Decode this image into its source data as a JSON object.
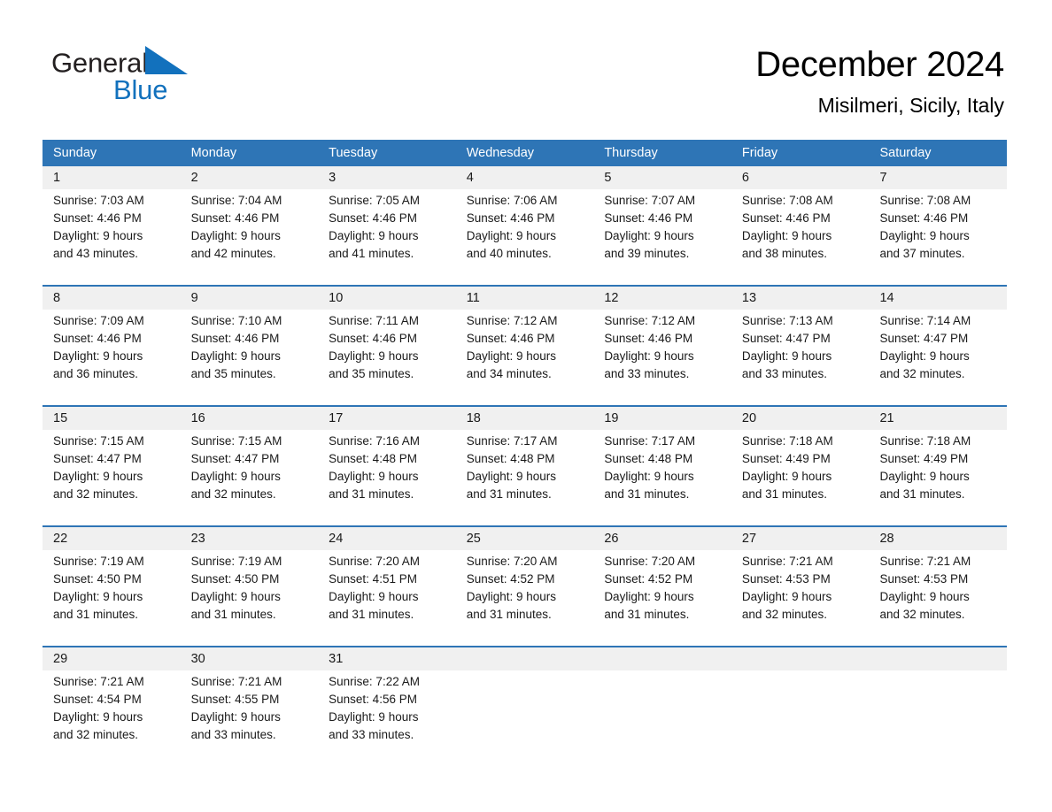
{
  "brand": {
    "word_general": "General",
    "word_blue": "Blue",
    "flag_color": "#1271bd",
    "text_color": "#231f20"
  },
  "header": {
    "month_title": "December 2024",
    "location": "Misilmeri, Sicily, Italy"
  },
  "theme": {
    "header_blue": "#2e75b6",
    "band_gray": "#f0f0f0",
    "text_dark": "#1a1a1a",
    "page_bg": "#ffffff"
  },
  "weekdays": [
    "Sunday",
    "Monday",
    "Tuesday",
    "Wednesday",
    "Thursday",
    "Friday",
    "Saturday"
  ],
  "weeks": [
    {
      "days": [
        {
          "num": "1",
          "l1": "Sunrise: 7:03 AM",
          "l2": "Sunset: 4:46 PM",
          "l3": "Daylight: 9 hours",
          "l4": "and 43 minutes."
        },
        {
          "num": "2",
          "l1": "Sunrise: 7:04 AM",
          "l2": "Sunset: 4:46 PM",
          "l3": "Daylight: 9 hours",
          "l4": "and 42 minutes."
        },
        {
          "num": "3",
          "l1": "Sunrise: 7:05 AM",
          "l2": "Sunset: 4:46 PM",
          "l3": "Daylight: 9 hours",
          "l4": "and 41 minutes."
        },
        {
          "num": "4",
          "l1": "Sunrise: 7:06 AM",
          "l2": "Sunset: 4:46 PM",
          "l3": "Daylight: 9 hours",
          "l4": "and 40 minutes."
        },
        {
          "num": "5",
          "l1": "Sunrise: 7:07 AM",
          "l2": "Sunset: 4:46 PM",
          "l3": "Daylight: 9 hours",
          "l4": "and 39 minutes."
        },
        {
          "num": "6",
          "l1": "Sunrise: 7:08 AM",
          "l2": "Sunset: 4:46 PM",
          "l3": "Daylight: 9 hours",
          "l4": "and 38 minutes."
        },
        {
          "num": "7",
          "l1": "Sunrise: 7:08 AM",
          "l2": "Sunset: 4:46 PM",
          "l3": "Daylight: 9 hours",
          "l4": "and 37 minutes."
        }
      ]
    },
    {
      "days": [
        {
          "num": "8",
          "l1": "Sunrise: 7:09 AM",
          "l2": "Sunset: 4:46 PM",
          "l3": "Daylight: 9 hours",
          "l4": "and 36 minutes."
        },
        {
          "num": "9",
          "l1": "Sunrise: 7:10 AM",
          "l2": "Sunset: 4:46 PM",
          "l3": "Daylight: 9 hours",
          "l4": "and 35 minutes."
        },
        {
          "num": "10",
          "l1": "Sunrise: 7:11 AM",
          "l2": "Sunset: 4:46 PM",
          "l3": "Daylight: 9 hours",
          "l4": "and 35 minutes."
        },
        {
          "num": "11",
          "l1": "Sunrise: 7:12 AM",
          "l2": "Sunset: 4:46 PM",
          "l3": "Daylight: 9 hours",
          "l4": "and 34 minutes."
        },
        {
          "num": "12",
          "l1": "Sunrise: 7:12 AM",
          "l2": "Sunset: 4:46 PM",
          "l3": "Daylight: 9 hours",
          "l4": "and 33 minutes."
        },
        {
          "num": "13",
          "l1": "Sunrise: 7:13 AM",
          "l2": "Sunset: 4:47 PM",
          "l3": "Daylight: 9 hours",
          "l4": "and 33 minutes."
        },
        {
          "num": "14",
          "l1": "Sunrise: 7:14 AM",
          "l2": "Sunset: 4:47 PM",
          "l3": "Daylight: 9 hours",
          "l4": "and 32 minutes."
        }
      ]
    },
    {
      "days": [
        {
          "num": "15",
          "l1": "Sunrise: 7:15 AM",
          "l2": "Sunset: 4:47 PM",
          "l3": "Daylight: 9 hours",
          "l4": "and 32 minutes."
        },
        {
          "num": "16",
          "l1": "Sunrise: 7:15 AM",
          "l2": "Sunset: 4:47 PM",
          "l3": "Daylight: 9 hours",
          "l4": "and 32 minutes."
        },
        {
          "num": "17",
          "l1": "Sunrise: 7:16 AM",
          "l2": "Sunset: 4:48 PM",
          "l3": "Daylight: 9 hours",
          "l4": "and 31 minutes."
        },
        {
          "num": "18",
          "l1": "Sunrise: 7:17 AM",
          "l2": "Sunset: 4:48 PM",
          "l3": "Daylight: 9 hours",
          "l4": "and 31 minutes."
        },
        {
          "num": "19",
          "l1": "Sunrise: 7:17 AM",
          "l2": "Sunset: 4:48 PM",
          "l3": "Daylight: 9 hours",
          "l4": "and 31 minutes."
        },
        {
          "num": "20",
          "l1": "Sunrise: 7:18 AM",
          "l2": "Sunset: 4:49 PM",
          "l3": "Daylight: 9 hours",
          "l4": "and 31 minutes."
        },
        {
          "num": "21",
          "l1": "Sunrise: 7:18 AM",
          "l2": "Sunset: 4:49 PM",
          "l3": "Daylight: 9 hours",
          "l4": "and 31 minutes."
        }
      ]
    },
    {
      "days": [
        {
          "num": "22",
          "l1": "Sunrise: 7:19 AM",
          "l2": "Sunset: 4:50 PM",
          "l3": "Daylight: 9 hours",
          "l4": "and 31 minutes."
        },
        {
          "num": "23",
          "l1": "Sunrise: 7:19 AM",
          "l2": "Sunset: 4:50 PM",
          "l3": "Daylight: 9 hours",
          "l4": "and 31 minutes."
        },
        {
          "num": "24",
          "l1": "Sunrise: 7:20 AM",
          "l2": "Sunset: 4:51 PM",
          "l3": "Daylight: 9 hours",
          "l4": "and 31 minutes."
        },
        {
          "num": "25",
          "l1": "Sunrise: 7:20 AM",
          "l2": "Sunset: 4:52 PM",
          "l3": "Daylight: 9 hours",
          "l4": "and 31 minutes."
        },
        {
          "num": "26",
          "l1": "Sunrise: 7:20 AM",
          "l2": "Sunset: 4:52 PM",
          "l3": "Daylight: 9 hours",
          "l4": "and 31 minutes."
        },
        {
          "num": "27",
          "l1": "Sunrise: 7:21 AM",
          "l2": "Sunset: 4:53 PM",
          "l3": "Daylight: 9 hours",
          "l4": "and 32 minutes."
        },
        {
          "num": "28",
          "l1": "Sunrise: 7:21 AM",
          "l2": "Sunset: 4:53 PM",
          "l3": "Daylight: 9 hours",
          "l4": "and 32 minutes."
        }
      ]
    },
    {
      "days": [
        {
          "num": "29",
          "l1": "Sunrise: 7:21 AM",
          "l2": "Sunset: 4:54 PM",
          "l3": "Daylight: 9 hours",
          "l4": "and 32 minutes."
        },
        {
          "num": "30",
          "l1": "Sunrise: 7:21 AM",
          "l2": "Sunset: 4:55 PM",
          "l3": "Daylight: 9 hours",
          "l4": "and 33 minutes."
        },
        {
          "num": "31",
          "l1": "Sunrise: 7:22 AM",
          "l2": "Sunset: 4:56 PM",
          "l3": "Daylight: 9 hours",
          "l4": "and 33 minutes."
        },
        {
          "num": "",
          "l1": "",
          "l2": "",
          "l3": "",
          "l4": ""
        },
        {
          "num": "",
          "l1": "",
          "l2": "",
          "l3": "",
          "l4": ""
        },
        {
          "num": "",
          "l1": "",
          "l2": "",
          "l3": "",
          "l4": ""
        },
        {
          "num": "",
          "l1": "",
          "l2": "",
          "l3": "",
          "l4": ""
        }
      ]
    }
  ]
}
